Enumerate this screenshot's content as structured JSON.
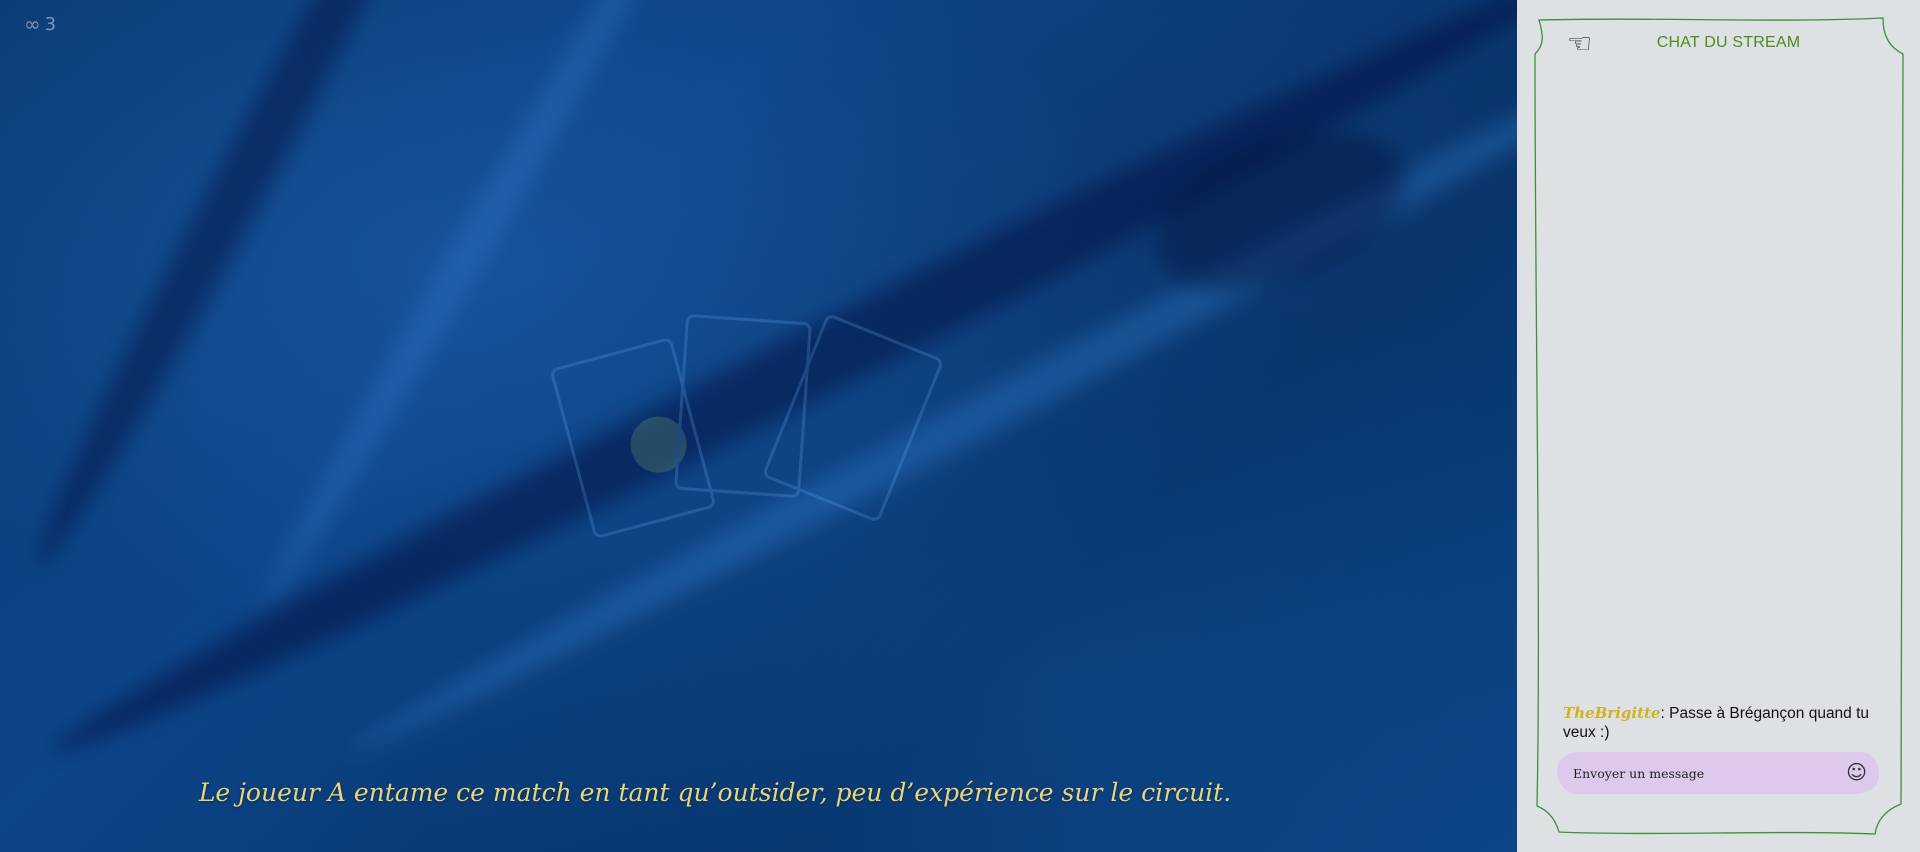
{
  "stream": {
    "viewer_icon": "infinity-icon",
    "viewer_count": "3",
    "subtitle": "Le joueur A entame ce match en tant qu’outsider, peu d’expérience sur le circuit."
  },
  "chat": {
    "title": "CHAT DU STREAM",
    "back_icon": "pointing-hand-icon",
    "messages": [
      {
        "user": "TheBrigitte",
        "separator": ": ",
        "text": "Passe à Brégançon quand tu veux :)"
      }
    ],
    "input": {
      "placeholder": "Envoyer un message",
      "value": ""
    },
    "emoji_icon": "smiley-icon"
  },
  "colors": {
    "stream_bg": "#0b3c76",
    "subtitle": "#e8d47a",
    "chat_bg": "#dde1e4",
    "chat_title": "#4f8a1c",
    "chat_border": "#3f8f3b",
    "username": "#d1b21f",
    "input_bg": "#dcc9ec"
  }
}
